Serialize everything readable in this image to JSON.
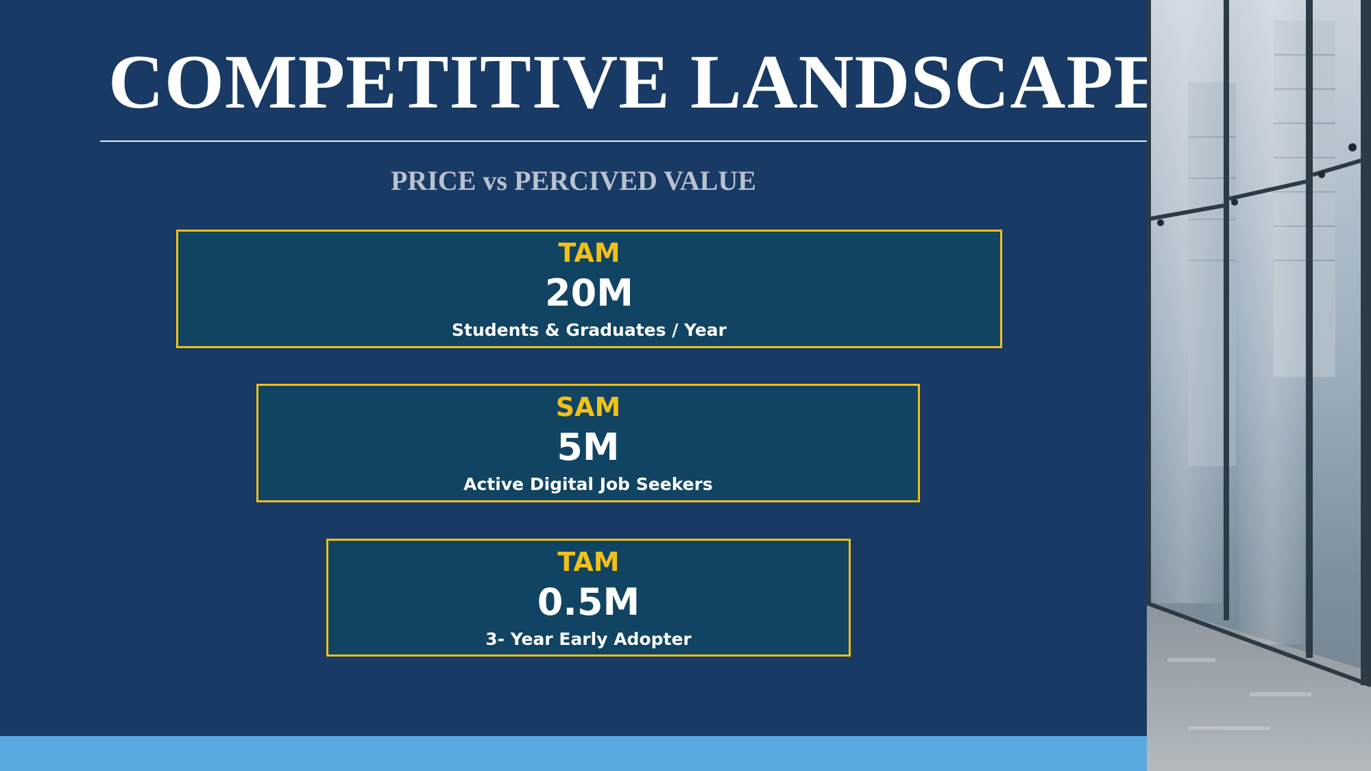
{
  "slide": {
    "title": "COMPETITIVE LANDSCAPE",
    "subtitle": "PRICE vs PERCIVED VALUE"
  },
  "markets": [
    {
      "tag": "TAM",
      "value": "20M",
      "description": "Students & Graduates / Year"
    },
    {
      "tag": "SAM",
      "value": "5M",
      "description": "Active Digital Job Seekers"
    },
    {
      "tag": "TAM",
      "value": "0.5M",
      "description": "3- Year Early Adopter"
    }
  ],
  "colors": {
    "background": "#183a64",
    "box_fill": "#104462",
    "box_border": "#f2c018",
    "accent_text": "#f2c018",
    "bottom_bar": "#5aa8e0",
    "subtitle": "#b9c2cf"
  },
  "image": {
    "description_icon": "glass-office-building-photo-icon"
  }
}
